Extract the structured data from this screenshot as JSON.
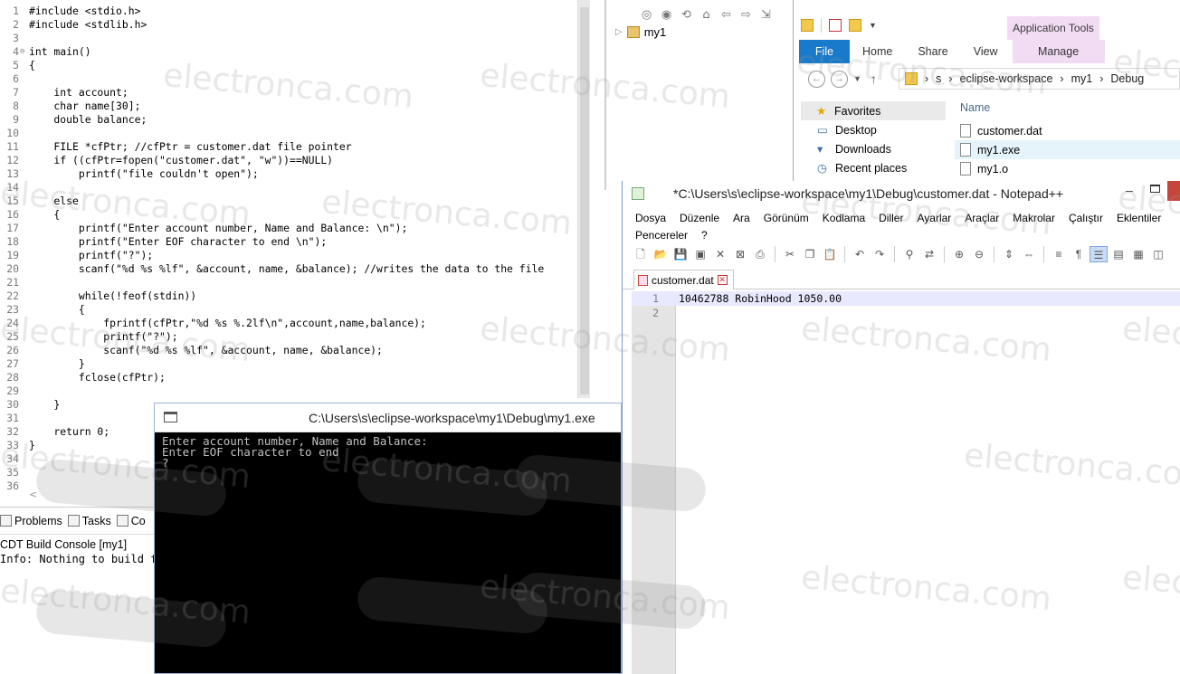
{
  "eclipse": {
    "code": [
      {
        "n": "1",
        "t": "#include <stdio.h>"
      },
      {
        "n": "2",
        "t": "#include <stdlib.h>"
      },
      {
        "n": "3",
        "t": ""
      },
      {
        "n": "4",
        "t": "int main()",
        "fold": "⊖"
      },
      {
        "n": "5",
        "t": "{"
      },
      {
        "n": "6",
        "t": ""
      },
      {
        "n": "7",
        "t": "    int account;"
      },
      {
        "n": "8",
        "t": "    char name[30];"
      },
      {
        "n": "9",
        "t": "    double balance;"
      },
      {
        "n": "10",
        "t": ""
      },
      {
        "n": "11",
        "t": "    FILE *cfPtr; //cfPtr = customer.dat file pointer"
      },
      {
        "n": "12",
        "t": "    if ((cfPtr=fopen(\"customer.dat\", \"w\"))==NULL)"
      },
      {
        "n": "13",
        "t": "        printf(\"file couldn't open\");"
      },
      {
        "n": "14",
        "t": ""
      },
      {
        "n": "15",
        "t": "    else"
      },
      {
        "n": "16",
        "t": "    {"
      },
      {
        "n": "17",
        "t": "        printf(\"Enter account number, Name and Balance: \\n\");"
      },
      {
        "n": "18",
        "t": "        printf(\"Enter EOF character to end \\n\");"
      },
      {
        "n": "19",
        "t": "        printf(\"?\");"
      },
      {
        "n": "20",
        "t": "        scanf(\"%d %s %lf\", &account, name, &balance); //writes the data to the file"
      },
      {
        "n": "21",
        "t": ""
      },
      {
        "n": "22",
        "t": "        while(!feof(stdin))"
      },
      {
        "n": "23",
        "t": "        {"
      },
      {
        "n": "24",
        "t": "            fprintf(cfPtr,\"%d %s %.2lf\\n\",account,name,balance);"
      },
      {
        "n": "25",
        "t": "            printf(\"?\");"
      },
      {
        "n": "26",
        "t": "            scanf(\"%d %s %lf\", &account, name, &balance);"
      },
      {
        "n": "27",
        "t": "        }"
      },
      {
        "n": "28",
        "t": "        fclose(cfPtr);"
      },
      {
        "n": "29",
        "t": ""
      },
      {
        "n": "30",
        "t": "    }"
      },
      {
        "n": "31",
        "t": ""
      },
      {
        "n": "32",
        "t": "    return 0;"
      },
      {
        "n": "33",
        "t": "}"
      },
      {
        "n": "34",
        "t": ""
      },
      {
        "n": "35",
        "t": ""
      },
      {
        "n": "36",
        "t": ""
      }
    ],
    "bottom_tabs": [
      {
        "label": "Problems",
        "icon": "problems-icon"
      },
      {
        "label": "Tasks",
        "icon": "tasks-icon"
      },
      {
        "label": "Co",
        "icon": "console-icon"
      }
    ],
    "console_title": "CDT Build Console [my1]",
    "console_text": "Info: Nothing to build fo",
    "project_name": "my1"
  },
  "file_explorer": {
    "app_tools": "Application Tools",
    "tabs": [
      "File",
      "Home",
      "Share",
      "View",
      "Manage"
    ],
    "path": [
      "s",
      "eclipse-workspace",
      "my1",
      "Debug"
    ],
    "nav": [
      "Favorites",
      "Desktop",
      "Downloads",
      "Recent places"
    ],
    "column_name": "Name",
    "files": [
      "customer.dat",
      "my1.exe",
      "my1.o"
    ]
  },
  "notepad": {
    "title": "*C:\\Users\\s\\eclipse-workspace\\my1\\Debug\\customer.dat - Notepad++",
    "menu": [
      "Dosya",
      "Düzenle",
      "Ara",
      "Görünüm",
      "Kodlama",
      "Diller",
      "Ayarlar",
      "Araçlar",
      "Makrolar",
      "Çalıştır",
      "Eklentiler",
      "Pencereler",
      "?"
    ],
    "tab": "customer.dat",
    "lines": [
      {
        "n": "1",
        "t": "10462788 RobinHood 1050.00"
      },
      {
        "n": "2",
        "t": ""
      }
    ]
  },
  "console_window": {
    "title": "C:\\Users\\s\\eclipse-workspace\\my1\\Debug\\my1.exe",
    "lines": [
      "Enter account number, Name and Balance:",
      "Enter EOF character to end",
      "?"
    ]
  },
  "watermark": "electronca.com",
  "colors": {
    "file_tab": "#1979ca",
    "manage_tab": "#f2dcf4",
    "notepad_close": "#c7463c",
    "console_bg": "#000000",
    "console_text": "#c0c0c0"
  }
}
